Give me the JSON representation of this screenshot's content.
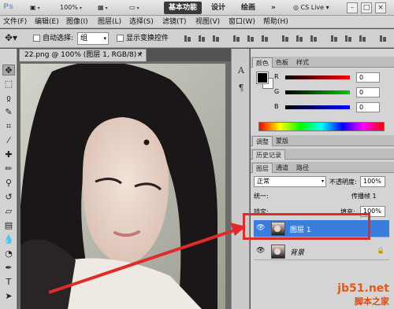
{
  "app": {
    "logo": "Ps",
    "zoom_label": "100%",
    "workspaces": [
      "基本功能",
      "设计",
      "绘画"
    ],
    "more_workspaces": "»",
    "cslive": "CS Live"
  },
  "menu": [
    "文件(F)",
    "编辑(E)",
    "图像(I)",
    "图层(L)",
    "选择(S)",
    "滤镜(T)",
    "视图(V)",
    "窗口(W)",
    "帮助(H)"
  ],
  "options": {
    "auto_select_label": "自动选择:",
    "auto_select_value": "组",
    "show_transform_label": "显示变换控件"
  },
  "document": {
    "tab_title": "22.png @ 100% (图层 1, RGB/8) *",
    "close": "×"
  },
  "panels": {
    "color_tabs": [
      "颜色",
      "色板",
      "样式"
    ],
    "rgb": [
      {
        "label": "R",
        "value": "0"
      },
      {
        "label": "G",
        "value": "0"
      },
      {
        "label": "B",
        "value": "0"
      }
    ],
    "adjust_tabs": [
      "调整",
      "蒙版"
    ],
    "history_tab": "历史记录",
    "layer_tabs": [
      "图层",
      "通道",
      "路径"
    ],
    "blend_mode": "正常",
    "opacity_label": "不透明度:",
    "opacity_value": "100%",
    "unify_label": "统一:",
    "propagate_label": "传播帧 1",
    "lock_label": "锁定:",
    "fill_label": "填充:",
    "fill_value": "100%",
    "layers": [
      {
        "name": "图层 1",
        "selected": true
      },
      {
        "name": "背景",
        "selected": false
      }
    ]
  },
  "watermark": {
    "line1": "jb51.net",
    "line2": "脚本之家"
  },
  "colors": {
    "accent": "#e02b2b",
    "selection": "#3a7ddc"
  }
}
